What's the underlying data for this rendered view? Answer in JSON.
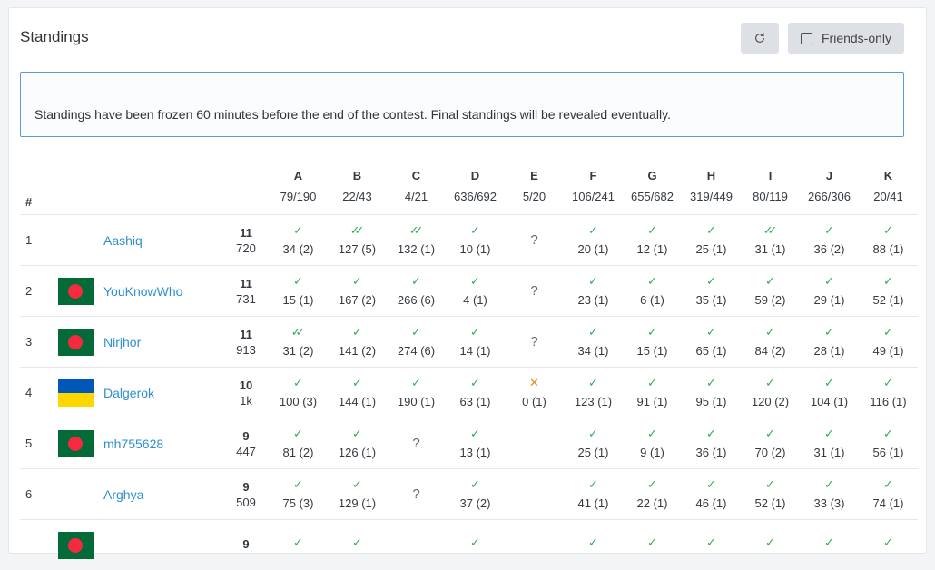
{
  "header": {
    "title": "Standings",
    "friends_only_label": "Friends-only"
  },
  "alert": {
    "text": "Standings have been frozen 60 minutes before the end of the contest. Final standings will be revealed eventually."
  },
  "table": {
    "rank_header": "#",
    "problems": [
      {
        "letter": "A",
        "ratio": "79/190"
      },
      {
        "letter": "B",
        "ratio": "22/43"
      },
      {
        "letter": "C",
        "ratio": "4/21"
      },
      {
        "letter": "D",
        "ratio": "636/692"
      },
      {
        "letter": "E",
        "ratio": "5/20"
      },
      {
        "letter": "F",
        "ratio": "106/241"
      },
      {
        "letter": "G",
        "ratio": "655/682"
      },
      {
        "letter": "H",
        "ratio": "319/449"
      },
      {
        "letter": "I",
        "ratio": "80/119"
      },
      {
        "letter": "J",
        "ratio": "266/306"
      },
      {
        "letter": "K",
        "ratio": "20/41"
      }
    ],
    "rows": [
      {
        "rank": "1",
        "flag": "none",
        "handle": "Aashiq",
        "solved": "11",
        "penalty": "720",
        "cells": [
          {
            "mark": "check",
            "text": "34 (2)"
          },
          {
            "mark": "double",
            "text": "127 (5)"
          },
          {
            "mark": "double",
            "text": "132 (1)"
          },
          {
            "mark": "check",
            "text": "10 (1)"
          },
          {
            "mark": "pending",
            "text": ""
          },
          {
            "mark": "check",
            "text": "20 (1)"
          },
          {
            "mark": "check",
            "text": "12 (1)"
          },
          {
            "mark": "check",
            "text": "25 (1)"
          },
          {
            "mark": "double",
            "text": "31 (1)"
          },
          {
            "mark": "check",
            "text": "36 (2)"
          },
          {
            "mark": "check",
            "text": "88 (1)"
          }
        ]
      },
      {
        "rank": "2",
        "flag": "bd",
        "handle": "YouKnowWho",
        "solved": "11",
        "penalty": "731",
        "cells": [
          {
            "mark": "check",
            "text": "15 (1)"
          },
          {
            "mark": "check",
            "text": "167 (2)"
          },
          {
            "mark": "check",
            "text": "266 (6)"
          },
          {
            "mark": "check",
            "text": "4 (1)"
          },
          {
            "mark": "pending",
            "text": ""
          },
          {
            "mark": "check",
            "text": "23 (1)"
          },
          {
            "mark": "check",
            "text": "6 (1)"
          },
          {
            "mark": "check",
            "text": "35 (1)"
          },
          {
            "mark": "check",
            "text": "59 (2)"
          },
          {
            "mark": "check",
            "text": "29 (1)"
          },
          {
            "mark": "check",
            "text": "52 (1)"
          }
        ]
      },
      {
        "rank": "3",
        "flag": "bd",
        "handle": "Nirjhor",
        "solved": "11",
        "penalty": "913",
        "cells": [
          {
            "mark": "double",
            "text": "31 (2)"
          },
          {
            "mark": "check",
            "text": "141 (2)"
          },
          {
            "mark": "check",
            "text": "274 (6)"
          },
          {
            "mark": "check",
            "text": "14 (1)"
          },
          {
            "mark": "pending",
            "text": ""
          },
          {
            "mark": "check",
            "text": "34 (1)"
          },
          {
            "mark": "check",
            "text": "15 (1)"
          },
          {
            "mark": "check",
            "text": "65 (1)"
          },
          {
            "mark": "check",
            "text": "84 (2)"
          },
          {
            "mark": "check",
            "text": "28 (1)"
          },
          {
            "mark": "check",
            "text": "49 (1)"
          }
        ]
      },
      {
        "rank": "4",
        "flag": "ua",
        "handle": "Dalgerok",
        "solved": "10",
        "penalty": "1k",
        "cells": [
          {
            "mark": "check",
            "text": "100 (3)"
          },
          {
            "mark": "check",
            "text": "144 (1)"
          },
          {
            "mark": "check",
            "text": "190 (1)"
          },
          {
            "mark": "check",
            "text": "63 (1)"
          },
          {
            "mark": "cross",
            "text": "0 (1)"
          },
          {
            "mark": "check",
            "text": "123 (1)"
          },
          {
            "mark": "check",
            "text": "91 (1)"
          },
          {
            "mark": "check",
            "text": "95 (1)"
          },
          {
            "mark": "check",
            "text": "120 (2)"
          },
          {
            "mark": "check",
            "text": "104 (1)"
          },
          {
            "mark": "check",
            "text": "116 (1)"
          }
        ]
      },
      {
        "rank": "5",
        "flag": "bd",
        "handle": "mh755628",
        "solved": "9",
        "penalty": "447",
        "cells": [
          {
            "mark": "check",
            "text": "81 (2)"
          },
          {
            "mark": "check",
            "text": "126 (1)"
          },
          {
            "mark": "pending",
            "text": ""
          },
          {
            "mark": "check",
            "text": "13 (1)"
          },
          {
            "mark": "none",
            "text": ""
          },
          {
            "mark": "check",
            "text": "25 (1)"
          },
          {
            "mark": "check",
            "text": "9 (1)"
          },
          {
            "mark": "check",
            "text": "36 (1)"
          },
          {
            "mark": "check",
            "text": "70 (2)"
          },
          {
            "mark": "check",
            "text": "31 (1)"
          },
          {
            "mark": "check",
            "text": "56 (1)"
          }
        ]
      },
      {
        "rank": "6",
        "flag": "none",
        "handle": "Arghya",
        "solved": "9",
        "penalty": "509",
        "cells": [
          {
            "mark": "check",
            "text": "75 (3)"
          },
          {
            "mark": "check",
            "text": "129 (1)"
          },
          {
            "mark": "pending",
            "text": ""
          },
          {
            "mark": "check",
            "text": "37 (2)"
          },
          {
            "mark": "none",
            "text": ""
          },
          {
            "mark": "check",
            "text": "41 (1)"
          },
          {
            "mark": "check",
            "text": "22 (1)"
          },
          {
            "mark": "check",
            "text": "46 (1)"
          },
          {
            "mark": "check",
            "text": "52 (1)"
          },
          {
            "mark": "check",
            "text": "33 (3)"
          },
          {
            "mark": "check",
            "text": "74 (1)"
          }
        ]
      },
      {
        "rank": "",
        "flag": "bd",
        "handle": "",
        "solved": "9",
        "penalty": "",
        "cells": [
          {
            "mark": "check",
            "text": ""
          },
          {
            "mark": "check",
            "text": ""
          },
          {
            "mark": "none",
            "text": ""
          },
          {
            "mark": "check",
            "text": ""
          },
          {
            "mark": "none",
            "text": ""
          },
          {
            "mark": "check",
            "text": ""
          },
          {
            "mark": "check",
            "text": ""
          },
          {
            "mark": "check",
            "text": ""
          },
          {
            "mark": "check",
            "text": ""
          },
          {
            "mark": "check",
            "text": ""
          },
          {
            "mark": "check",
            "text": ""
          }
        ]
      }
    ]
  },
  "icons": {
    "refresh": "refresh-icon",
    "check": "check-icon",
    "double": "double-check-icon",
    "cross": "cross-icon",
    "pending": "question-icon"
  },
  "colors": {
    "accepted": "#2fae5a",
    "rejected": "#e88a1f",
    "link": "#2f8fd2",
    "alert_border": "#5b9bd5"
  }
}
